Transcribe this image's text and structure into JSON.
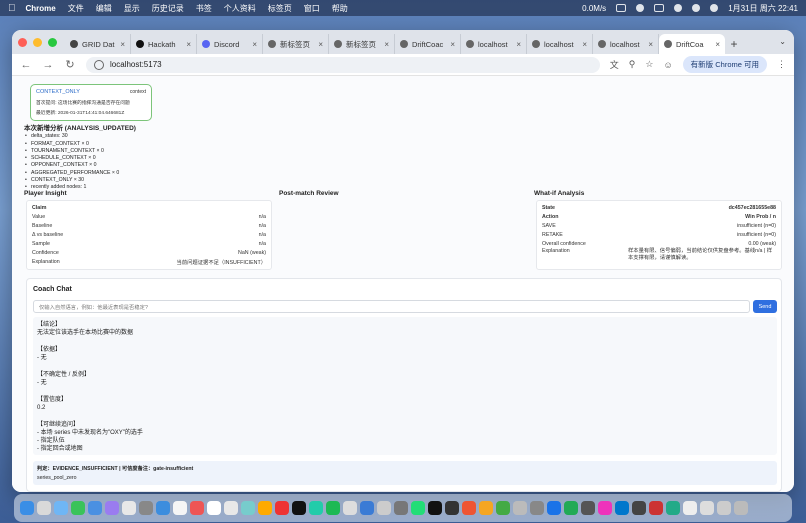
{
  "menubar": {
    "app": "Chrome",
    "items": [
      "文件",
      "编辑",
      "显示",
      "历史记录",
      "书签",
      "个人资料",
      "标签页",
      "窗口",
      "帮助"
    ],
    "network": "0.0M/s",
    "datetime": "1月31日 周六  22:41"
  },
  "tabs": [
    {
      "label": "GRID Dat",
      "color": "#444"
    },
    {
      "label": "Hackath",
      "color": "#111"
    },
    {
      "label": "Discord",
      "color": "#5865f2"
    },
    {
      "label": "新标签页",
      "color": "#666"
    },
    {
      "label": "新标签页",
      "color": "#666"
    },
    {
      "label": "DriftCoac",
      "color": "#666"
    },
    {
      "label": "localhost",
      "color": "#666"
    },
    {
      "label": "localhost",
      "color": "#666"
    },
    {
      "label": "localhost",
      "color": "#666"
    },
    {
      "label": "DriftCoa",
      "color": "#666",
      "active": true
    }
  ],
  "toolbar": {
    "url": "localhost:5173",
    "update_chip": "有新版 Chrome 可用"
  },
  "context_card": {
    "title": "CONTEXT_ONLY",
    "tag": "context",
    "line1": "首次提问: 这场比赛的指挥沟通是否存在问题",
    "line2": "最近更新: 2026-01-31T14:41:04.646681Z"
  },
  "analysis": {
    "heading": "本次新增分析 (ANALYSIS_UPDATED)",
    "items": [
      "delta_states: 30",
      "FORMAT_CONTEXT × 0",
      "TOURNAMENT_CONTEXT × 0",
      "SCHEDULE_CONTEXT × 0",
      "OPPONENT_CONTEXT × 0",
      "AGGREGATED_PERFORMANCE × 0",
      "CONTEXT_ONLY × 30",
      "recently added nodes: 1"
    ]
  },
  "player_insight": {
    "title": "Player Insight",
    "rows": [
      {
        "k": "Claim",
        "v": ""
      },
      {
        "k": "Value",
        "v": "n/a"
      },
      {
        "k": "Baseline",
        "v": "n/a"
      },
      {
        "k": "Δ vs baseline",
        "v": "n/a"
      },
      {
        "k": "Sample",
        "v": "n/a"
      },
      {
        "k": "Confidence",
        "v": "NaN (weak)"
      },
      {
        "k": "Explanation",
        "v": "当前问题证据不足（INSUFFICIENT）"
      }
    ]
  },
  "post_match": {
    "title": "Post-match Review"
  },
  "what_if": {
    "title": "What-if Analysis",
    "rows": [
      {
        "k": "State",
        "v": "dc457ec281655e88"
      },
      {
        "k": "Action",
        "v": "Win Prob / n"
      },
      {
        "k": "SAVE",
        "v": "insufficient (n=0)"
      },
      {
        "k": "RETAKE",
        "v": "insufficient (n=0)"
      },
      {
        "k": "Overall confidence",
        "v": "0.00 (weak)"
      }
    ],
    "explanation_label": "Explanation",
    "explanation": "样本量有限、信号偏弱，当前结论仅供复盘参考。基线n/a | 样本支撑有限，请谨慎解读。"
  },
  "chat": {
    "title": "Coach Chat",
    "placeholder": "仅输入自然语言，例如：他最近表现是否稳定?",
    "send": "Send",
    "answer_blocks": [
      [
        "【结论】",
        "无法定位该选手在本场比赛中的数据"
      ],
      [
        "【依据】",
        "- 无"
      ],
      [
        "【不确定性 / 反例】",
        "- 无"
      ],
      [
        "【置信度】",
        "0.2"
      ],
      [
        "【可继续追问】",
        "- 本场 series 中未发现名为\"OXY\"的选手",
        "- 指定队伍",
        "- 指定回合或地图"
      ]
    ],
    "verdict": "判定：EVIDENCE_INSUFFICIENT | 可信度备注：gate-insufficient",
    "verdict_sub": "series_pool_zero"
  },
  "dock_colors": [
    "#3a8ee6",
    "#d9d9d9",
    "#6fb6f5",
    "#3ac35a",
    "#4a90e2",
    "#9a7cf0",
    "#e8e8e8",
    "#888",
    "#3c8dde",
    "#f5f5f5",
    "#e55",
    "#fff",
    "#e8e8e8",
    "#7cc",
    "#fa0",
    "#e33",
    "#111",
    "#2ca",
    "#1db954",
    "#ddd",
    "#3a7bd5",
    "#ccc",
    "#777",
    "#2d7",
    "#111",
    "#333",
    "#e53",
    "#f5a623",
    "#4a4",
    "#bbb",
    "#888",
    "#1a73e8",
    "#2a5",
    "#555",
    "#e3b",
    "#07c",
    "#444",
    "#c33",
    "#2a8",
    "#eee",
    "#ddd",
    "#ccc",
    "#bbb"
  ]
}
